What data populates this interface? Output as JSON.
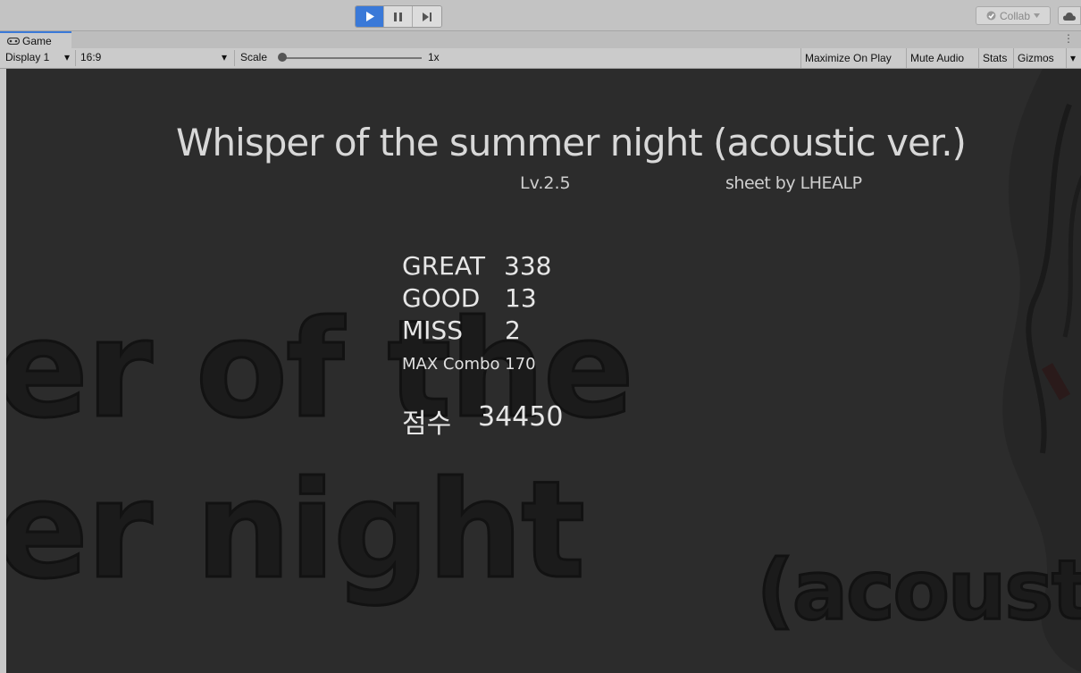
{
  "toolbar": {
    "collab_label": "Collab",
    "accent_color": "#3a79d8"
  },
  "tab": {
    "label": "Game",
    "icon": "gamepad-icon",
    "menu_glyph": "⋮"
  },
  "controls": {
    "display": "Display 1",
    "aspect": "16:9",
    "scale_label": "Scale",
    "scale_value": "1x",
    "buttons": [
      "Maximize On Play",
      "Mute Audio",
      "Stats",
      "Gizmos"
    ]
  },
  "game": {
    "title": "Whisper of the summer night (acoustic ver.)",
    "level": "Lv.2.5",
    "sheet": "sheet by LHEALP",
    "stats": [
      {
        "label": "GREAT",
        "value": "338"
      },
      {
        "label": "GOOD",
        "value": "13"
      },
      {
        "label": "MISS",
        "value": "2"
      }
    ],
    "max_combo": "MAX Combo 170",
    "score_label": "점수",
    "score_value": "34450",
    "background_text": [
      "er of the",
      "er night",
      "(acoustic"
    ]
  }
}
